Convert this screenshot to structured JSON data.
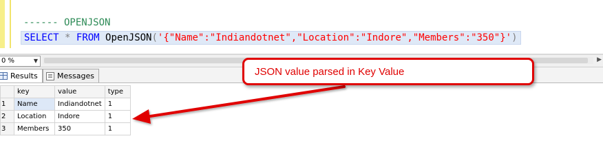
{
  "editor": {
    "comment_line": "------ OPENJSON",
    "query": {
      "select": "SELECT",
      "star": "*",
      "from": "FROM",
      "func": "OpenJSON",
      "open_paren": "(",
      "json_literal": "'{\"Name\":\"Indiandotnet\",\"Location\":\"Indore\",\"Members\":\"350\"}'",
      "close_paren": ")"
    }
  },
  "zoom": {
    "value": "0 %",
    "dropdown_icon": "chevron-down-icon"
  },
  "tabs": [
    {
      "label": "Results",
      "icon": "grid-icon"
    },
    {
      "label": "Messages",
      "icon": "message-icon"
    }
  ],
  "results": {
    "columns": [
      "key",
      "value",
      "type"
    ],
    "rows": [
      {
        "num": "1",
        "key": "Name",
        "value": "Indiandotnet",
        "type": "1"
      },
      {
        "num": "2",
        "key": "Location",
        "value": "Indore",
        "type": "1"
      },
      {
        "num": "3",
        "key": "Members",
        "value": "350",
        "type": "1"
      }
    ]
  },
  "annotation": {
    "text": "JSON value parsed in Key Value",
    "color": "#e00000"
  },
  "colors": {
    "keyword": "#0000ff",
    "string": "#ff0000",
    "comment": "#2e8b57",
    "selection": "#dfe9f7"
  }
}
